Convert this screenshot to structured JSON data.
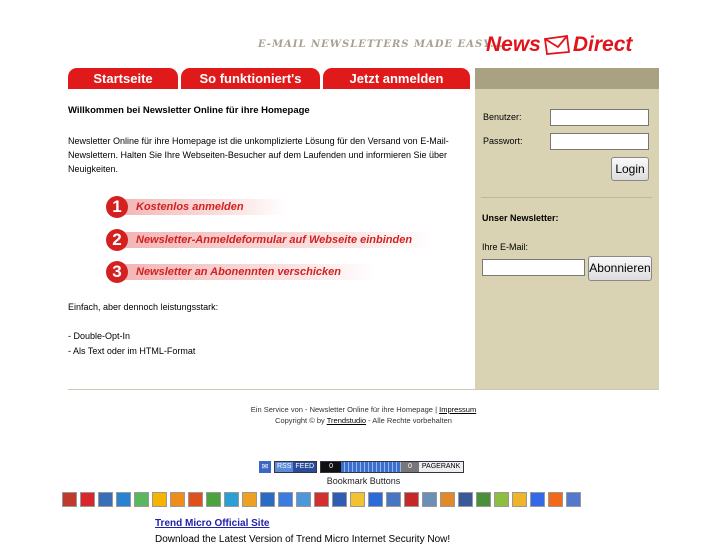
{
  "header": {
    "tagline": "E-MAIL NEWSLETTERS MADE EASY...",
    "logo_left": "News",
    "logo_right": "Direct"
  },
  "nav": {
    "tabs": [
      {
        "label": "Startseite"
      },
      {
        "label": "So funktioniert's"
      },
      {
        "label": "Jetzt anmelden"
      }
    ]
  },
  "main": {
    "title": "Willkommen bei Newsletter Online für ihre Homepage",
    "intro": "Newsletter Online für ihre Homepage ist die unkomplizierte Lösung für den Versand von E-Mail-Newslettern. Halten Sie Ihre Webseiten-Besucher auf dem Laufenden und informieren Sie über Neuigkeiten.",
    "steps": [
      {
        "num": "1",
        "text": "Kostenlos anmelden"
      },
      {
        "num": "2",
        "text": "Newsletter-Anmeldeformular auf Webseite einbinden"
      },
      {
        "num": "3",
        "text": "Newsletter an Abonennten verschicken"
      }
    ],
    "features_heading": "Einfach, aber dennoch leistungsstark:",
    "features": [
      "- Double-Opt-In",
      "- Als Text oder im HTML-Format"
    ]
  },
  "sidebar": {
    "user_label": "Benutzer:",
    "password_label": "Passwort:",
    "user_value": "",
    "password_value": "",
    "login_button": "Login",
    "newsletter_heading": "Unser Newsletter:",
    "email_label": "Ihre E-Mail:",
    "email_value": "",
    "subscribe_button": "Abonnieren"
  },
  "footer": {
    "line1_text": "Ein Service von - Newsletter Online für ihre Homepage",
    "separator": "|",
    "impressum_link": "Impressum",
    "line2_prefix": "Copyright © by",
    "trendstudio_link": "Trendstudio",
    "line2_suffix": "- Alle Rechte vorbehalten"
  },
  "badges": {
    "rss": "RSS",
    "feed": "FEED",
    "pagerank_value": "0",
    "pagerank_score": "0",
    "pagerank_label": "PAGERANK",
    "bookmark_label": "Bookmark Buttons"
  },
  "bookmarks": [
    {
      "icon": "bookmark-icon",
      "color": "#c0392b"
    },
    {
      "icon": "bookmark-icon",
      "color": "#d9262c"
    },
    {
      "icon": "bookmark-icon",
      "color": "#3a6fb7"
    },
    {
      "icon": "bookmark-icon",
      "color": "#2a83d1"
    },
    {
      "icon": "bookmark-icon",
      "color": "#5bb75b"
    },
    {
      "icon": "bookmark-icon",
      "color": "#f4b400"
    },
    {
      "icon": "bookmark-icon",
      "color": "#f08c1a"
    },
    {
      "icon": "bookmark-icon",
      "color": "#e0501e"
    },
    {
      "icon": "bookmark-icon",
      "color": "#4aa33d"
    },
    {
      "icon": "bookmark-icon",
      "color": "#2a9fd6"
    },
    {
      "icon": "bookmark-icon",
      "color": "#f0a020"
    },
    {
      "icon": "bookmark-icon",
      "color": "#2a6cc4"
    },
    {
      "icon": "bookmark-icon",
      "color": "#3c7be0"
    },
    {
      "icon": "bookmark-icon",
      "color": "#4c98d8"
    },
    {
      "icon": "bookmark-icon",
      "color": "#d22f2f"
    },
    {
      "icon": "bookmark-icon",
      "color": "#2f5db3"
    },
    {
      "icon": "bookmark-icon",
      "color": "#f2c230"
    },
    {
      "icon": "bookmark-icon",
      "color": "#2a6bd8"
    },
    {
      "icon": "bookmark-icon",
      "color": "#4776c2"
    },
    {
      "icon": "bookmark-icon",
      "color": "#c62828"
    },
    {
      "icon": "bookmark-icon",
      "color": "#6c8fb8"
    },
    {
      "icon": "bookmark-icon",
      "color": "#e08a2a"
    },
    {
      "icon": "bookmark-icon",
      "color": "#3b5998"
    },
    {
      "icon": "bookmark-icon",
      "color": "#4a8f3a"
    },
    {
      "icon": "bookmark-icon",
      "color": "#8cbf3f"
    },
    {
      "icon": "bookmark-icon",
      "color": "#f0b429"
    },
    {
      "icon": "bookmark-icon",
      "color": "#3369e8"
    },
    {
      "icon": "bookmark-icon",
      "color": "#f06a1a"
    },
    {
      "icon": "bookmark-icon",
      "color": "#5577cc"
    }
  ],
  "ad": {
    "title": "Trend Micro Official Site",
    "text": "Download the Latest Version of Trend Micro Internet Security Now!"
  }
}
